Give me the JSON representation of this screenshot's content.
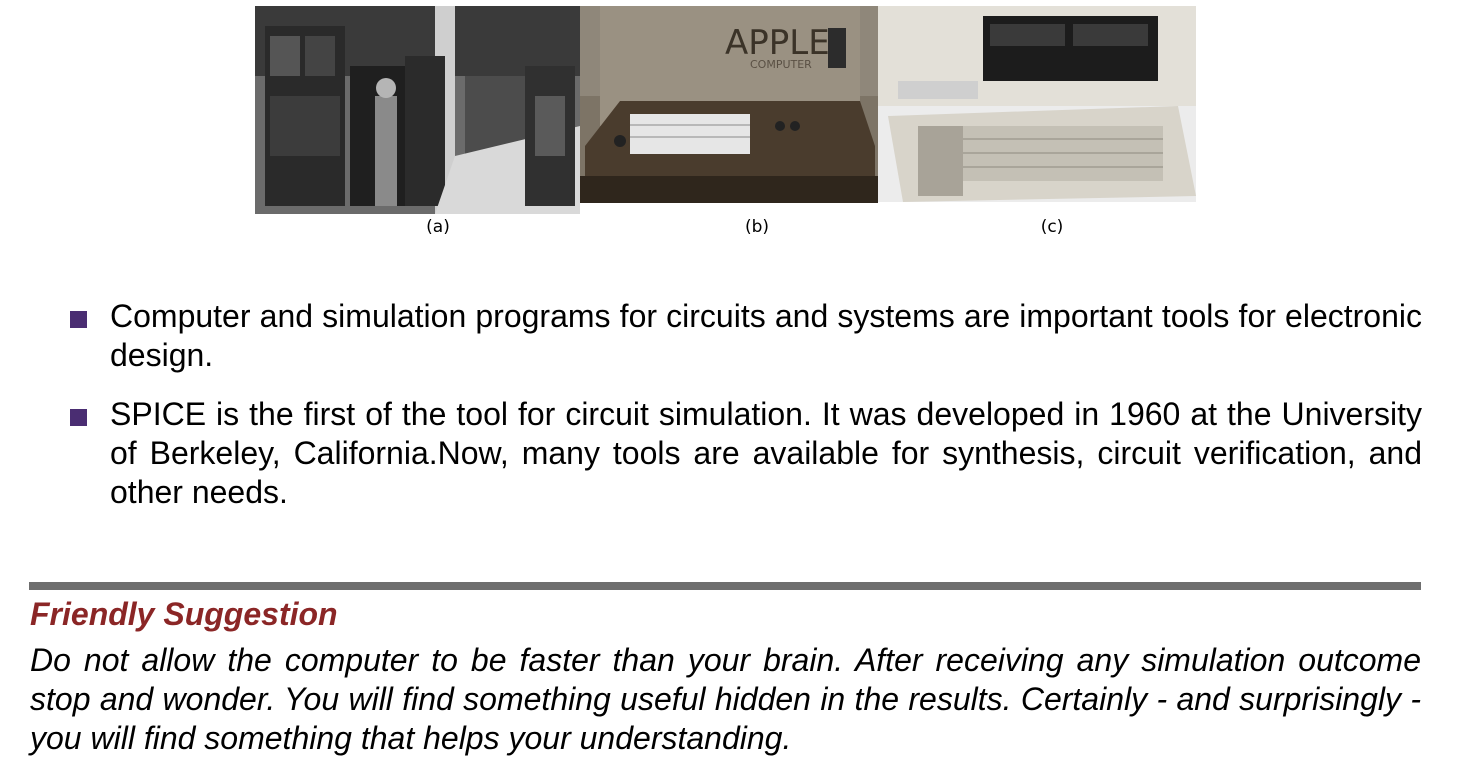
{
  "figure": {
    "captions": [
      "(a)",
      "(b)",
      "(c)"
    ],
    "photo_b_sign": {
      "top": "APPLE",
      "bottom": "COMPUTER"
    },
    "images": [
      "eniac-photo",
      "apple-1-photo",
      "ibm-pc-photo"
    ]
  },
  "bullets": [
    {
      "text": "Computer and simulation programs for circuits and systems are important tools for electronic design."
    },
    {
      "text": "SPICE is the first of the tool for circuit simulation.  It was developed in 1960 at the University of Berkeley, California.Now, many tools are available for synthesis, circuit verification, and other needs."
    }
  ],
  "suggestion": {
    "title": "Friendly Suggestion",
    "body": "Do not allow the computer to be faster than your brain.  After receiving any simulation outcome stop and wonder. You will find something useful hidden in the results. Certainly - and surprisingly - you will find something that helps your understanding."
  },
  "colors": {
    "bullet": "#4a2d72",
    "rule": "#6e6e6e",
    "title": "#8b2626"
  }
}
